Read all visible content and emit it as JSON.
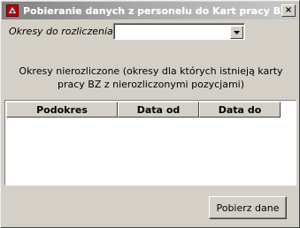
{
  "window": {
    "title": "Pobieranie danych z personelu do Kart pracy BZ",
    "close_glyph": "×"
  },
  "filter": {
    "label": "Okresy do rozliczenia:",
    "selected_value": ""
  },
  "info": {
    "text": "Okresy nierozliczone (okresy dla których istnieją karty pracy BZ z nierozliczonymi pozycjami)"
  },
  "table": {
    "columns": [
      "Podokres",
      "Data od",
      "Data do"
    ],
    "rows": []
  },
  "actions": {
    "fetch_label": "Pobierz dane"
  },
  "colors": {
    "dialog_bg": "#d4d0c8",
    "titlebar_inactive": "#808080"
  }
}
